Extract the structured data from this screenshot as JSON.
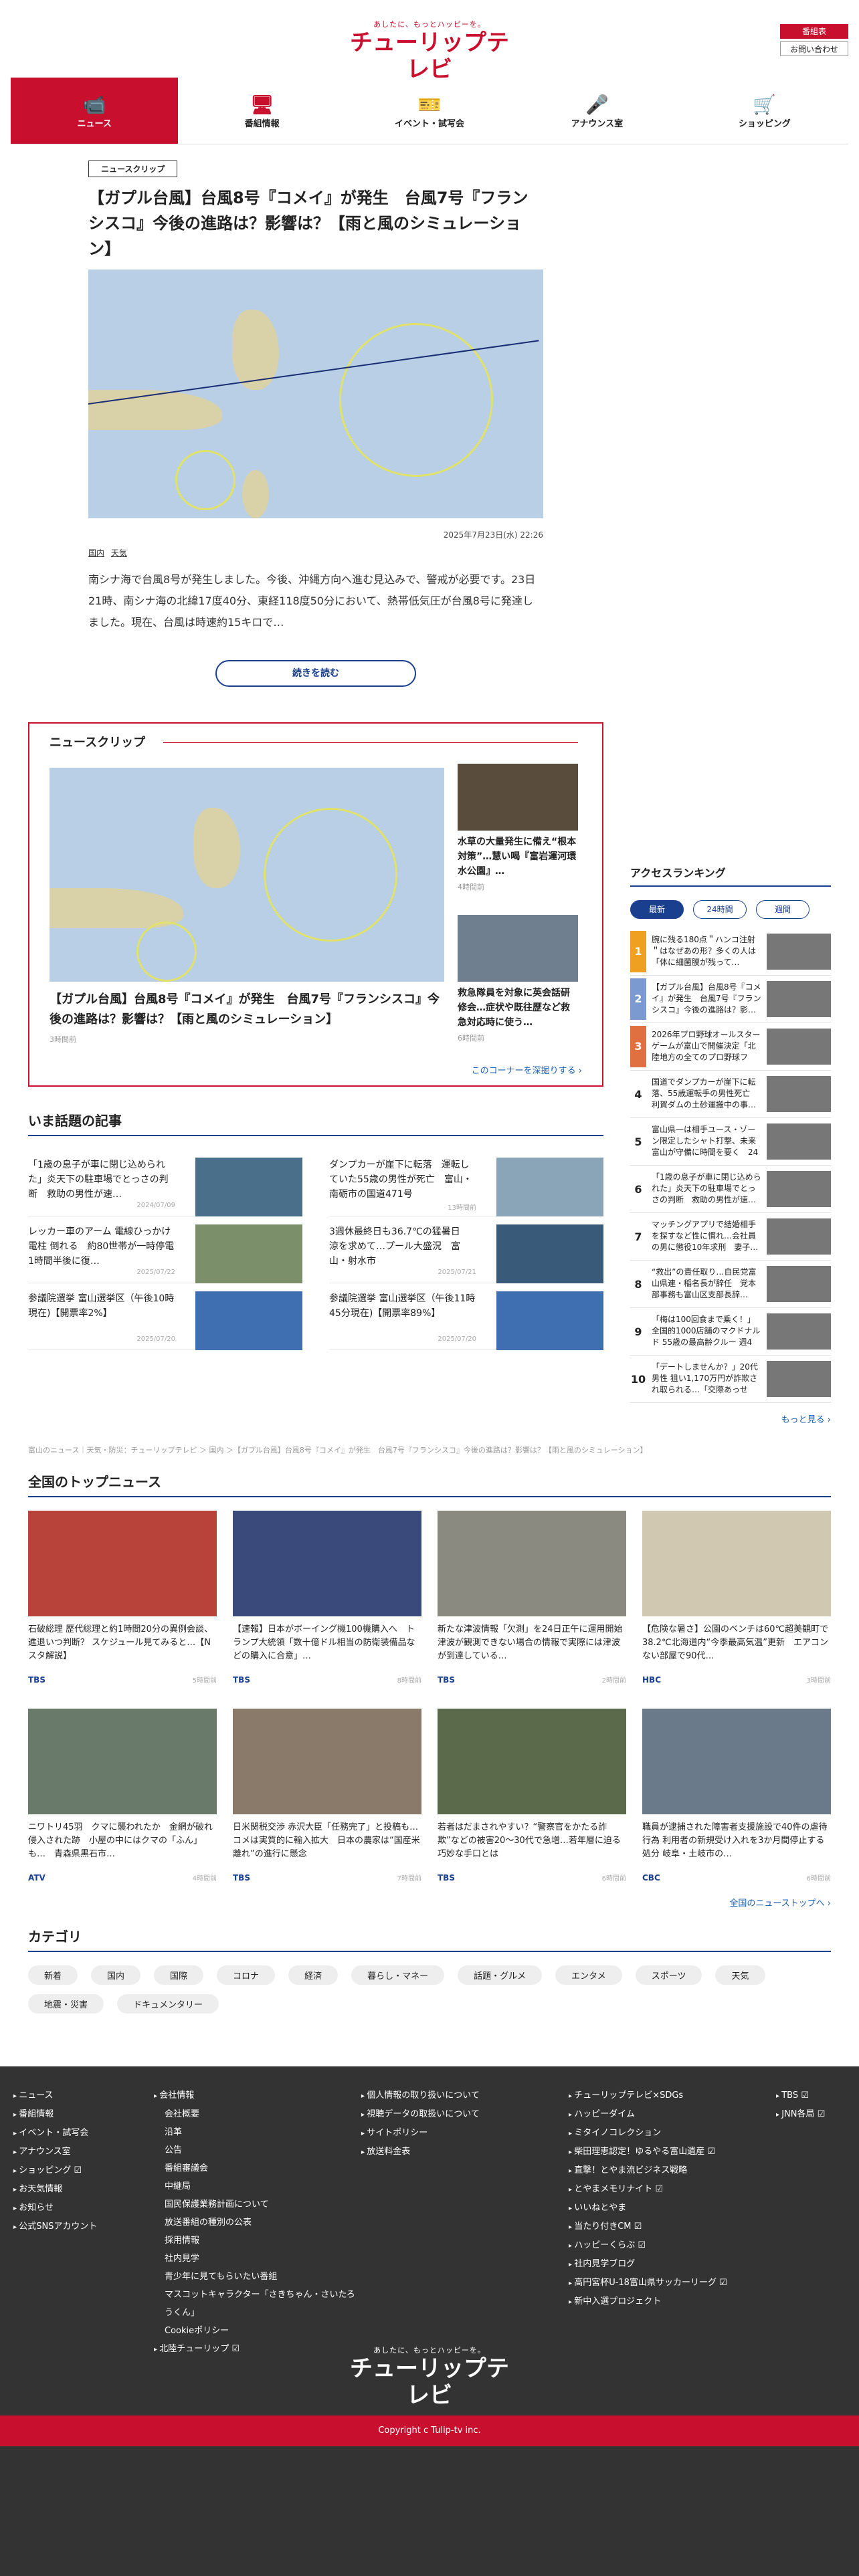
{
  "header": {
    "logo_tagline": "あしたに、もっとハッピーを。",
    "logo_main": "チューリップテレビ",
    "link_schedule": "番組表",
    "link_contact": "お問い合わせ"
  },
  "gnav": [
    {
      "label": "ニュース",
      "icon": "📹"
    },
    {
      "label": "番組情報",
      "icon": "🖥"
    },
    {
      "label": "イベント・試写会",
      "icon": "🎫"
    },
    {
      "label": "アナウンス室",
      "icon": "🎤"
    },
    {
      "label": "ショッピング",
      "icon": "🛒"
    }
  ],
  "feature": {
    "tag": "ニュースクリップ",
    "title": "【ガプル台風】台風8号『コメイ』が発生　台風7号『フランシスコ』今後の進路は？影響は？【雨と風のシミュレーション】",
    "date": "2025年7月23日(水) 22:26",
    "cat1": "国内",
    "cat2": "天気",
    "body": "南シナ海で台風8号が発生しました。今後、沖縄方向へ進む見込みで、警戒が必要です。23日21時、南シナ海の北緯17度40分、東経118度50分において、熱帯低気圧が台風8号に発達しました。現在、台風は時速約15キロで…",
    "readmore": "続きを読む"
  },
  "clip": {
    "title": "ニュースクリップ",
    "main_title": "【ガプル台風】台風8号『コメイ』が発生　台風7号『フランシスコ』今後の進路は？影響は？【雨と風のシミュレーション】",
    "main_ago": "3時間前",
    "side": [
      {
        "title": "水草の大量発生に備え“根本対策”…慧い喝『富岩運河環水公園』…",
        "ago": "4時間前"
      },
      {
        "title": "救急隊員を対象に英会話研修会…症状や既往歴など救急対応時に使う…",
        "ago": "6時間前"
      }
    ],
    "more": "このコーナーを深掘りする ›"
  },
  "ranking": {
    "title": "アクセスランキング",
    "tabs": [
      "最新",
      "24時間",
      "週間"
    ],
    "items": [
      {
        "num": "1",
        "text": "腕に残る180点＂ハンコ注射＂はなぜあの形？多くの人は「体に細菌膜が残って…"
      },
      {
        "num": "2",
        "text": "【ガプル台風】台風8号『コメイ』が発生　台風7号『フランシスコ』今後の進路は？影…"
      },
      {
        "num": "3",
        "text": "2026年プロ野球オールスターゲームが富山で開催決定「北陸地方の全てのプロ野球ファ…"
      },
      {
        "num": "4",
        "text": "国道でダンプカーが崖下に転落、55歳運転手の男性死亡　利賀ダムの土砂運搬中の事…"
      },
      {
        "num": "5",
        "text": "富山県一は相手ユース・ゾーン限定したシャト打撃、未来富山が守備に時間を要く　24日の準決…"
      },
      {
        "num": "6",
        "text": "「1歳の息子が車に閉じ込められた」炎天下の駐車場でとっさの判断　救助の男性が速…"
      },
      {
        "num": "7",
        "text": "マッチングアプリで結婚相手を探すなど性に慣れ…会社員の男に懲役10年求刑　妻子…"
      },
      {
        "num": "8",
        "text": "“救出”の責任取り…自民党富山県連・稲名長が辞任　党本部事務も富山区支部長辞…"
      },
      {
        "num": "9",
        "text": "「梅は100回食まで乗く！」全国的1000店舗のマクドナルド 55歳の最高齢クルー 週4日…"
      },
      {
        "num": "10",
        "text": "「デートしませんか？」20代男性 狙い1,170万円が詐欺され取られる…「交際あっせん…"
      }
    ],
    "more": "もっと見る ›"
  },
  "hot": {
    "title": "いま話題の記事",
    "items": [
      {
        "title": "「1歳の息子が車に閉じ込められた」炎天下の駐車場でとっさの判断　救助の男性が速…",
        "ago": "2024/07/09"
      },
      {
        "title": "ダンプカーが崖下に転落　運転していた55歳の男性が死亡　富山・南砺市の国道471号",
        "ago": "13時間前"
      },
      {
        "title": "レッカー車のアーム 電線ひっかけ電柱 倒れる　約80世帯が一時停電　1時間半後に復…",
        "ago": "2025/07/22"
      },
      {
        "title": "3週休最終日も36.7℃の猛暑日　涼を求めて…プール大盛況　富山・射水市",
        "ago": "2025/07/21"
      },
      {
        "title": "参議院選挙 富山選挙区（午後10時現在)【開票率2%】",
        "ago": "2025/07/20"
      },
      {
        "title": "参議院選挙 富山選挙区（午後11時45分現在)【開票率89%】",
        "ago": "2025/07/20"
      }
    ]
  },
  "breadcrumb": "富山のニュース｜天気・防災：チューリップテレビ ＞ 国内 ＞【ガプル台風】台風8号『コメイ』が発生　台風7号『フランシスコ』今後の進路は？影響は？【雨と風のシミュレーション】",
  "topnews": {
    "title": "全国のトップニュース",
    "items": [
      {
        "title": "石破総理 歴代総理と約1時間20分の異例会談、進退いつ判断？ スケジュール見てみると…【N スタ解説】",
        "source": "TBS",
        "ago": "5時間前"
      },
      {
        "title": "【速報】日本がボーイング機100機購入へ　トランプ大統領「数十億ドル相当の防衛装備品などの購入に合意」…",
        "source": "TBS",
        "ago": "8時間前"
      },
      {
        "title": "新たな津波情報「欠測」を24日正午に運用開始　津波が観測できない場合の情報で実際には津波が到達している…",
        "source": "TBS",
        "ago": "2時間前"
      },
      {
        "title": "【危険な暑さ】公園のベンチは60℃超美観町で38.2℃北海道内“今季最高気温”更新　エアコンない部屋で90代…",
        "source": "HBC",
        "ago": "3時間前"
      },
      {
        "title": "ニワトリ45羽　クマに襲われたか　金網が破れ侵入された跡　小屋の中にはクマの「ふん」も…　青森県黒石市…",
        "source": "ATV",
        "ago": "4時間前"
      },
      {
        "title": "日米関税交渉 赤沢大臣「任務完了」と投稿も…コメは実質的に輸入拡大　日本の農家は“国産米離れ”の進行に懸念",
        "source": "TBS",
        "ago": "7時間前"
      },
      {
        "title": "若者はだまされやすい？“警察官をかたる詐欺”などの被害20〜30代で急増…若年層に迫る巧妙な手口とは",
        "source": "TBS",
        "ago": "6時間前"
      },
      {
        "title": "職員が逮捕された障害者支援施設で40件の虐待行為 利用者の新規受け入れを3か月間停止する処分 岐阜・土岐市の…",
        "source": "CBC",
        "ago": "6時間前"
      }
    ],
    "more": "全国のニューストップへ ›"
  },
  "category": {
    "title": "カテゴリ",
    "items": [
      "新着",
      "国内",
      "国際",
      "コロナ",
      "経済",
      "暮らし・マネー",
      "話題・グルメ",
      "エンタメ",
      "スポーツ",
      "天気",
      "地震・災害",
      "ドキュメンタリー"
    ]
  },
  "footer": {
    "col1": [
      "ニュース",
      "番組情報",
      "イベント・試写会",
      "アナウンス室",
      "ショッピング ☑",
      "お天気情報",
      "お知らせ",
      "公式SNSアカウント"
    ],
    "col2": [
      "会社情報",
      "会社概要",
      "沿革",
      "公告",
      "番組審議会",
      "中継局",
      "国民保護業務計画について",
      "放送番組の種別の公表",
      "採用情報",
      "社内見学",
      "青少年に見てもらいたい番組",
      "マスコットキャラクター「さきちゃん・さいたろうくん」",
      "Cookieポリシー",
      "北陸チューリップ ☑"
    ],
    "col3": [
      "個人情報の取り扱いについて",
      "視聴データの取扱いについて",
      "サイトポリシー",
      "放送料金表"
    ],
    "col4": [
      "チューリップテレビ×SDGs",
      "ハッピーダイム",
      "ミタイノコレクション",
      "柴田理恵認定！ゆるやる富山遺産 ☑",
      "直撃！とやま流ビジネス戦略",
      "とやまメモリナイト ☑",
      "いいねとやま",
      "当たり付きCM ☑",
      "ハッピーくらぶ ☑",
      "社内見学ブログ",
      "高円宮杯U-18富山県サッカーリーグ ☑",
      "新中入選プロジェクト"
    ],
    "col5": [
      "TBS ☑",
      "JNN各局 ☑"
    ],
    "copyright": "Copyright c Tulip-tv inc."
  },
  "colors": {
    "brand": "#c8102e",
    "navy": "#1a3f8f"
  }
}
